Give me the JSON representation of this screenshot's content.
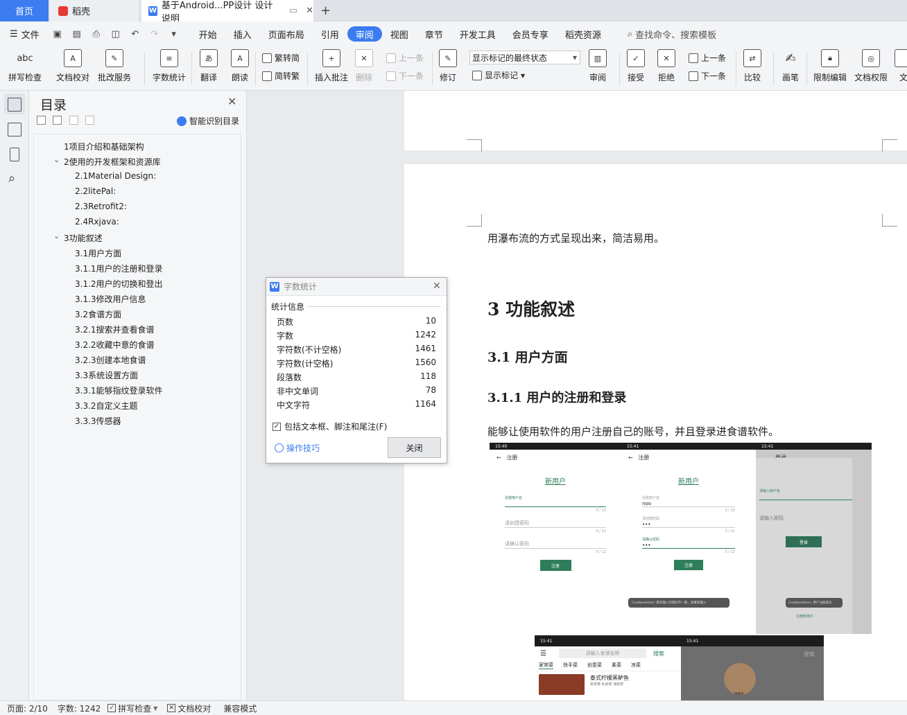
{
  "tabs": {
    "home": "首页",
    "daoke": "稻壳",
    "doc": "基于Android...PP设计 设计说明"
  },
  "menu": {
    "file": "文件",
    "items": [
      "开始",
      "插入",
      "页面布局",
      "引用",
      "审阅",
      "视图",
      "章节",
      "开发工具",
      "会员专享",
      "稻壳资源"
    ],
    "active": "审阅",
    "search": "查找命令、搜索模板"
  },
  "ribbon": {
    "spell": "拼写检查",
    "proof": "文档校对",
    "batch": "批改服务",
    "wordcount": "字数统计",
    "translate": "翻译",
    "read": "朗读",
    "trad": "繁转简",
    "simp": "简转繁",
    "insert_comment": "插入批注",
    "delete": "删除",
    "prev_comment": "上一条",
    "next_comment": "下一条",
    "revise": "修订",
    "markup_state": "显示标记的最终状态",
    "show_markup": "显示标记",
    "review": "审阅",
    "accept": "接受",
    "reject": "拒绝",
    "prev": "上一条",
    "next": "下一条",
    "compare": "比较",
    "pen": "画笔",
    "restrict": "限制编辑",
    "rights": "文档权限",
    "more": "文"
  },
  "toc": {
    "title": "目录",
    "smart": "智能识别目录",
    "items": [
      "1项目介绍和基础架构",
      "2使用的开发框架和资源库",
      "2.1Material Design:",
      "2.2litePal:",
      "2.3Retrofit2:",
      "2.4Rxjava:",
      "3功能叙述",
      "3.1用户方面",
      "3.1.1用户的注册和登录",
      "3.1.2用户的切换和登出",
      "3.1.3修改用户信息",
      "3.2食谱方面",
      "3.2.1搜索并查看食谱",
      "3.2.2收藏中意的食谱",
      "3.2.3创建本地食谱",
      "3.3系统设置方面",
      "3.3.1能够指纹登录软件",
      "3.3.2自定义主题",
      "3.3.3传感器"
    ]
  },
  "doc": {
    "line1": "用瀑布流的方式呈现出来，简洁易用。",
    "h1": "3  功能叙述",
    "h2": "3.1  用户方面",
    "h3": "3.1.1 用户的注册和登录",
    "para": "能够让使用软件的用户注册自己的账号，并且登录进食谱软件。",
    "phones": {
      "time1": "15:40",
      "time2": "15:41",
      "reg": "注册",
      "login": "登录",
      "newuser": "新用户",
      "ph_user": "创建用户名",
      "ph_pwd": "请创建密码",
      "ph_pwd2": "请确认密码",
      "ph_uname": "请输入用户名",
      "ph_lpwd": "请输入密码",
      "val_user": "noo",
      "reg_btn": "注册",
      "login_btn": "登录",
      "counter": "0 / 12",
      "counter3": "3 / 12",
      "toast1": "CookbookUser: 两次输入的密码不一致，请重新输入",
      "toast2": "CookbookUser: 用户注册成功",
      "newreg": "注册新用户",
      "search_ph": "请输入食谱名称",
      "search": "搜索",
      "cats": [
        "家常菜",
        "快手菜",
        "创意菜",
        "素菜",
        "凉菜"
      ],
      "dish": "泰式柠檬蒸鲈鱼",
      "dish_sub": "家常菜 私房菜 海鲜类",
      "profile": "noo"
    }
  },
  "dialog": {
    "title": "字数统计",
    "section": "统计信息",
    "rows": [
      {
        "k": "页数",
        "v": "10"
      },
      {
        "k": "字数",
        "v": "1242"
      },
      {
        "k": "字符数(不计空格)",
        "v": "1461"
      },
      {
        "k": "字符数(计空格)",
        "v": "1560"
      },
      {
        "k": "段落数",
        "v": "118"
      },
      {
        "k": "非中文单词",
        "v": "78"
      },
      {
        "k": "中文字符",
        "v": "1164"
      }
    ],
    "include": "包括文本框、脚注和尾注(F)",
    "tips": "操作技巧",
    "close": "关闭"
  },
  "status": {
    "page": "页面: 2/10",
    "words": "字数: 1242",
    "spell": "拼写检查",
    "proof": "文档校对",
    "compat": "兼容模式"
  }
}
